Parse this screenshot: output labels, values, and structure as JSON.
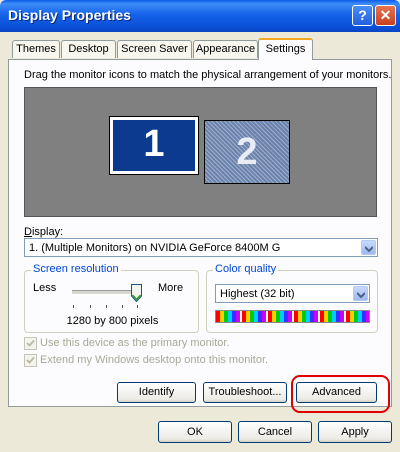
{
  "window": {
    "title": "Display Properties",
    "help_glyph": "?",
    "close_glyph": "✕"
  },
  "tabs": [
    {
      "label": "Themes"
    },
    {
      "label": "Desktop"
    },
    {
      "label": "Screen Saver"
    },
    {
      "label": "Appearance"
    },
    {
      "label": "Settings",
      "active": true
    }
  ],
  "instructions": "Drag the monitor icons to match the physical arrangement of your monitors.",
  "monitors": [
    {
      "label": "1",
      "selected": true
    },
    {
      "label": "2",
      "selected": false
    }
  ],
  "display": {
    "label": "Display:",
    "value": "1. (Multiple Monitors) on NVIDIA GeForce 8400M G"
  },
  "resolution": {
    "legend": "Screen resolution",
    "less": "Less",
    "more": "More",
    "value": "1280 by 800 pixels",
    "slider_level": 1.0
  },
  "color_quality": {
    "legend": "Color quality",
    "value": "Highest (32 bit)"
  },
  "checkboxes": [
    {
      "label": "Use this device as the primary monitor.",
      "checked": true,
      "disabled": true
    },
    {
      "label": "Extend my Windows desktop onto this monitor.",
      "checked": true,
      "disabled": true
    }
  ],
  "buttons": {
    "identify": "Identify",
    "troubleshoot": "Troubleshoot...",
    "advanced": "Advanced",
    "ok": "OK",
    "cancel": "Cancel",
    "apply": "Apply"
  },
  "colors": {
    "titlebar": "#0a5ae8",
    "accent_highlight": "#e00000",
    "group_legend": "#0046d5",
    "monitor_selected": "#0b3a8f"
  }
}
